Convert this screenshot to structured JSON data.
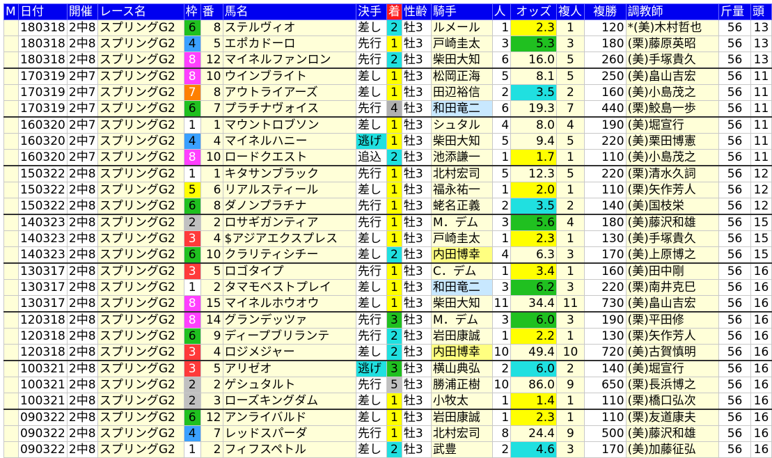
{
  "header": {
    "m": "M",
    "date": "日付",
    "venue": "開催",
    "race": "レース名",
    "waku": "枠",
    "ban": "番",
    "horse": "馬名",
    "kimete": "決手",
    "chaku": "着",
    "seirei": "性齢",
    "jockey": "騎手",
    "ninki": "人",
    "odds": "オッズ",
    "fukusho_ninki": "複人",
    "fukusho": "複勝",
    "trainer": "調教師",
    "kinryo": "斤量",
    "tousu": "頭"
  },
  "colors": {
    "header_bg": "#0000f0",
    "chaku_header_bg": "#ff1a1a",
    "row_bg": "#ffffd8",
    "waku": {
      "1": "#ffffff",
      "2": "#c0c0c0",
      "3": "#ff3a3a",
      "4": "#3aa0ff",
      "5": "#ffff00",
      "6": "#20c020",
      "7": "#ff8000",
      "8": "#ff40ff"
    },
    "chaku": {
      "1": "#ffff00",
      "2": "#20e0e0",
      "3": "#20c020",
      "4": "#b0b0b0",
      "5": "#c0c0c0"
    },
    "odds": {
      "1": "#ffff00",
      "2": "#20e0e0",
      "3": "#20c020"
    },
    "trainer_miho": "#d45f00",
    "trainer_ritto": "#0000c0"
  },
  "rows": [
    {
      "m": "",
      "date": "180318",
      "venue": "2中8",
      "race": "スプリングG2",
      "waku": "6",
      "ban": "8",
      "horse": "ステルヴィオ",
      "kimete": "差し",
      "chaku": "2",
      "seirei": "牡3",
      "jockey": "ルメール",
      "jc": "b",
      "ninki": "1",
      "odds": "2.3",
      "oc": "1",
      "fn": "1",
      "fukusho": "120",
      "trainer": "*(美)木村哲也",
      "tc": "m",
      "kinryo": "56",
      "tousu": "13"
    },
    {
      "m": "",
      "date": "180318",
      "venue": "2中8",
      "race": "スプリングG2",
      "waku": "4",
      "ban": "5",
      "horse": "エポカドーロ",
      "kimete": "先行",
      "chaku": "1",
      "seirei": "牡3",
      "jockey": "戸崎圭太",
      "jc": "o",
      "ninki": "3",
      "odds": "5.3",
      "oc": "3",
      "fn": "3",
      "fukusho": "180",
      "trainer": "(栗)藤原英昭",
      "tc": "k",
      "kinryo": "56",
      "tousu": "13"
    },
    {
      "m": "",
      "date": "180318",
      "venue": "2中8",
      "race": "スプリングG2",
      "waku": "8",
      "ban": "12",
      "horse": "マイネルファンロン",
      "kimete": "先行",
      "chaku": "2",
      "seirei": "牡3",
      "jockey": "柴田大知",
      "jc": "o",
      "ninki": "6",
      "odds": "16.0",
      "oc": "",
      "fn": "5",
      "fukusho": "260",
      "trainer": "(美)手塚貴久",
      "tc": "m",
      "kinryo": "56",
      "tousu": "13"
    },
    {
      "sep": true,
      "m": "",
      "date": "170319",
      "venue": "2中7",
      "race": "スプリングG2",
      "waku": "8",
      "ban": "10",
      "horse": "ウインブライト",
      "kimete": "差し",
      "chaku": "1",
      "seirei": "牡3",
      "jockey": "松岡正海",
      "jc": "o",
      "ninki": "5",
      "odds": "8.1",
      "oc": "",
      "fn": "5",
      "fukusho": "250",
      "trainer": "(美)畠山吉宏",
      "tc": "m",
      "kinryo": "56",
      "tousu": "11"
    },
    {
      "m": "",
      "date": "170319",
      "venue": "2中7",
      "race": "スプリングG2",
      "waku": "7",
      "ban": "8",
      "horse": "アウトライアーズ",
      "kimete": "差し",
      "chaku": "1",
      "seirei": "牡3",
      "jockey": "田辺裕信",
      "jc": "o",
      "ninki": "2",
      "odds": "3.5",
      "oc": "2",
      "fn": "2",
      "fukusho": "160",
      "trainer": "(美)小島茂之",
      "tc": "m",
      "kinryo": "56",
      "tousu": "11"
    },
    {
      "m": "",
      "date": "170319",
      "venue": "2中7",
      "race": "スプリングG2",
      "waku": "6",
      "ban": "7",
      "horse": "プラチナヴォイス",
      "kimete": "先行",
      "chaku": "4",
      "seirei": "牡3",
      "jockey": "和田竜二",
      "jc": "hb",
      "ninki": "6",
      "odds": "19.3",
      "oc": "",
      "fn": "7",
      "fukusho": "440",
      "trainer": "(栗)鮫島一歩",
      "tc": "k",
      "kinryo": "56",
      "tousu": "11"
    },
    {
      "sep": true,
      "m": "",
      "date": "160320",
      "venue": "2中7",
      "race": "スプリングG2",
      "waku": "1",
      "ban": "1",
      "horse": "マウントロブソン",
      "kimete": "差し",
      "chaku": "1",
      "seirei": "牡3",
      "jockey": "シュタル",
      "jc": "o",
      "ninki": "4",
      "odds": "8.0",
      "oc": "",
      "fn": "4",
      "fukusho": "190",
      "trainer": "(美)堀宣行",
      "tc": "m",
      "kinryo": "56",
      "tousu": "11"
    },
    {
      "m": "",
      "date": "160320",
      "venue": "2中7",
      "race": "スプリングG2",
      "waku": "4",
      "ban": "4",
      "horse": "マイネルハニー",
      "kimete": "逃げ",
      "chaku": "1",
      "seirei": "牡3",
      "jockey": "柴田大知",
      "jc": "o",
      "ninki": "5",
      "odds": "9.4",
      "oc": "",
      "fn": "5",
      "fukusho": "220",
      "trainer": "(美)栗田博憲",
      "tc": "m",
      "kinryo": "56",
      "tousu": "11"
    },
    {
      "m": "",
      "date": "160320",
      "venue": "2中7",
      "race": "スプリングG2",
      "waku": "8",
      "ban": "10",
      "horse": "ロードクエスト",
      "kimete": "追込",
      "chaku": "2",
      "seirei": "牡3",
      "jockey": "池添謙一",
      "jc": "b",
      "ninki": "1",
      "odds": "1.7",
      "oc": "1",
      "fn": "1",
      "fukusho": "110",
      "trainer": "(美)小島茂之",
      "tc": "m",
      "kinryo": "56",
      "tousu": "11"
    },
    {
      "sep": true,
      "m": "",
      "date": "150322",
      "venue": "2中8",
      "race": "スプリングG2",
      "waku": "1",
      "ban": "1",
      "horse": "キタサンブラック",
      "kimete": "先行",
      "chaku": "1",
      "seirei": "牡3",
      "jockey": "北村宏司",
      "jc": "o",
      "ninki": "5",
      "odds": "12.3",
      "oc": "",
      "fn": "5",
      "fukusho": "220",
      "trainer": "(栗)清水久詞",
      "tc": "k",
      "kinryo": "56",
      "tousu": "12"
    },
    {
      "m": "",
      "date": "150322",
      "venue": "2中8",
      "race": "スプリングG2",
      "waku": "5",
      "ban": "6",
      "horse": "リアルスティール",
      "kimete": "差し",
      "chaku": "1",
      "seirei": "牡3",
      "jockey": "福永祐一",
      "jc": "b",
      "ninki": "1",
      "odds": "2.0",
      "oc": "1",
      "fn": "1",
      "fukusho": "110",
      "trainer": "(栗)矢作芳人",
      "tc": "k",
      "kinryo": "56",
      "tousu": "12"
    },
    {
      "m": "",
      "date": "150322",
      "venue": "2中8",
      "race": "スプリングG2",
      "waku": "6",
      "ban": "8",
      "horse": "ダノンプラチナ",
      "kimete": "先行",
      "chaku": "1",
      "seirei": "牡3",
      "jockey": "蛯名正義",
      "jc": "o",
      "ninki": "2",
      "odds": "3.5",
      "oc": "2",
      "fn": "2",
      "fukusho": "140",
      "trainer": "(美)国枝栄",
      "tc": "m",
      "kinryo": "56",
      "tousu": "12"
    },
    {
      "sep": true,
      "m": "",
      "date": "140323",
      "venue": "2中8",
      "race": "スプリングG2",
      "waku": "2",
      "ban": "2",
      "horse": "ロサギガンティア",
      "kimete": "先行",
      "chaku": "1",
      "seirei": "牡3",
      "jockey": "M．デム",
      "jc": "b",
      "ninki": "3",
      "odds": "5.6",
      "oc": "3",
      "fn": "4",
      "fukusho": "180",
      "trainer": "(美)藤沢和雄",
      "tc": "m",
      "kinryo": "56",
      "tousu": "15"
    },
    {
      "m": "",
      "date": "140323",
      "venue": "2中8",
      "race": "スプリングG2",
      "waku": "3",
      "ban": "4",
      "horse": "$アジアエクスプレス",
      "kimete": "差し",
      "chaku": "1",
      "seirei": "牡3",
      "jockey": "戸崎圭太",
      "jc": "o",
      "ninki": "1",
      "odds": "2.3",
      "oc": "1",
      "fn": "1",
      "fukusho": "130",
      "trainer": "(美)手塚貴久",
      "tc": "m",
      "kinryo": "56",
      "tousu": "15"
    },
    {
      "m": "",
      "date": "140323",
      "venue": "2中8",
      "race": "スプリングG2",
      "waku": "6",
      "ban": "10",
      "horse": "クラリティシチー",
      "kimete": "差し",
      "chaku": "2",
      "seirei": "牡3",
      "jockey": "内田博幸",
      "jc": "hl",
      "ninki": "4",
      "odds": "6.3",
      "oc": "",
      "fn": "3",
      "fukusho": "170",
      "trainer": "(美)上原博之",
      "tc": "m",
      "kinryo": "56",
      "tousu": "15"
    },
    {
      "sep": true,
      "m": "",
      "date": "130317",
      "venue": "2中8",
      "race": "スプリングG2",
      "waku": "3",
      "ban": "5",
      "horse": "ロゴタイプ",
      "kimete": "先行",
      "chaku": "1",
      "seirei": "牡3",
      "jockey": "C．デム",
      "jc": "o",
      "ninki": "1",
      "odds": "3.4",
      "oc": "1",
      "fn": "1",
      "fukusho": "160",
      "trainer": "(美)田中剛",
      "tc": "m",
      "kinryo": "56",
      "tousu": "16"
    },
    {
      "m": "",
      "date": "130317",
      "venue": "2中8",
      "race": "スプリングG2",
      "waku": "1",
      "ban": "2",
      "horse": "タマモベストプレイ",
      "kimete": "差し",
      "chaku": "1",
      "seirei": "牡3",
      "jockey": "和田竜二",
      "jc": "hb",
      "ninki": "3",
      "odds": "6.2",
      "oc": "3",
      "fn": "3",
      "fukusho": "220",
      "trainer": "(栗)南井克巳",
      "tc": "k",
      "kinryo": "56",
      "tousu": "16"
    },
    {
      "m": "",
      "date": "130317",
      "venue": "2中8",
      "race": "スプリングG2",
      "waku": "8",
      "ban": "15",
      "horse": "マイネルホウオウ",
      "kimete": "差し",
      "chaku": "1",
      "seirei": "牡3",
      "jockey": "柴田大知",
      "jc": "o",
      "ninki": "11",
      "odds": "34.4",
      "oc": "",
      "fn": "11",
      "fukusho": "730",
      "trainer": "(美)畠山吉宏",
      "tc": "m",
      "kinryo": "56",
      "tousu": "16"
    },
    {
      "sep": true,
      "m": "",
      "date": "120318",
      "venue": "2中8",
      "race": "スプリングG2",
      "waku": "8",
      "ban": "14",
      "horse": "グランデッツァ",
      "kimete": "先行",
      "chaku": "3",
      "seirei": "牡3",
      "jockey": "M．デム",
      "jc": "b",
      "ninki": "3",
      "odds": "6.0",
      "oc": "3",
      "fn": "3",
      "fukusho": "190",
      "trainer": "(栗)平田修",
      "tc": "k",
      "kinryo": "56",
      "tousu": "16"
    },
    {
      "m": "",
      "date": "120318",
      "venue": "2中8",
      "race": "スプリングG2",
      "waku": "6",
      "ban": "9",
      "horse": "ディープブリランテ",
      "kimete": "先行",
      "chaku": "2",
      "seirei": "牡3",
      "jockey": "岩田康誠",
      "jc": "b",
      "ninki": "1",
      "odds": "2.2",
      "oc": "1",
      "fn": "1",
      "fukusho": "130",
      "trainer": "(栗)矢作芳人",
      "tc": "k",
      "kinryo": "56",
      "tousu": "16"
    },
    {
      "m": "",
      "date": "120318",
      "venue": "2中8",
      "race": "スプリングG2",
      "waku": "3",
      "ban": "4",
      "horse": "ロジメジャー",
      "kimete": "差し",
      "chaku": "2",
      "seirei": "牡3",
      "jockey": "内田博幸",
      "jc": "hl",
      "ninki": "10",
      "odds": "49.4",
      "oc": "",
      "fn": "10",
      "fukusho": "720",
      "trainer": "(美)古賀慎明",
      "tc": "m",
      "kinryo": "56",
      "tousu": "16"
    },
    {
      "sep": true,
      "m": "",
      "date": "100321",
      "venue": "2中8",
      "race": "スプリングG2",
      "waku": "3",
      "ban": "5",
      "horse": "アリゼオ",
      "kimete": "逃げ",
      "chaku": "3",
      "seirei": "牡3",
      "jockey": "横山典弘",
      "jc": "o",
      "ninki": "2",
      "odds": "6.0",
      "oc": "2",
      "fn": "2",
      "fukusho": "140",
      "trainer": "(美)堀宣行",
      "tc": "m",
      "kinryo": "56",
      "tousu": "16"
    },
    {
      "m": "",
      "date": "100321",
      "venue": "2中8",
      "race": "スプリングG2",
      "waku": "2",
      "ban": "2",
      "horse": "ゲシュタルト",
      "kimete": "先行",
      "chaku": "5",
      "seirei": "牡3",
      "jockey": "勝浦正樹",
      "jc": "o",
      "ninki": "10",
      "odds": "86.0",
      "oc": "",
      "fn": "9",
      "fukusho": "650",
      "trainer": "(栗)長浜博之",
      "tc": "k",
      "kinryo": "56",
      "tousu": "16"
    },
    {
      "m": "",
      "date": "100321",
      "venue": "2中8",
      "race": "スプリングG2",
      "waku": "2",
      "ban": "3",
      "horse": "ローズキングダム",
      "kimete": "差し",
      "chaku": "1",
      "seirei": "牡3",
      "jockey": "小牧太",
      "jc": "b",
      "ninki": "1",
      "odds": "1.4",
      "oc": "1",
      "fn": "1",
      "fukusho": "110",
      "trainer": "(栗)橋口弘次",
      "tc": "k",
      "kinryo": "56",
      "tousu": "16"
    },
    {
      "sep": true,
      "m": "",
      "date": "090322",
      "venue": "2中8",
      "race": "スプリングG2",
      "waku": "6",
      "ban": "12",
      "horse": "アンライバルド",
      "kimete": "差し",
      "chaku": "1",
      "seirei": "牡3",
      "jockey": "岩田康誠",
      "jc": "b",
      "ninki": "1",
      "odds": "2.3",
      "oc": "1",
      "fn": "1",
      "fukusho": "110",
      "trainer": "(栗)友道康夫",
      "tc": "k",
      "kinryo": "56",
      "tousu": "16"
    },
    {
      "m": "",
      "date": "090322",
      "venue": "2中8",
      "race": "スプリングG2",
      "waku": "4",
      "ban": "7",
      "horse": "レッドスパーダ",
      "kimete": "先行",
      "chaku": "1",
      "seirei": "牡3",
      "jockey": "北村宏司",
      "jc": "o",
      "ninki": "8",
      "odds": "24.4",
      "oc": "",
      "fn": "9",
      "fukusho": "500",
      "trainer": "(美)藤沢和雄",
      "tc": "m",
      "kinryo": "56",
      "tousu": "16"
    },
    {
      "m": "",
      "date": "090322",
      "venue": "2中8",
      "race": "スプリングG2",
      "waku": "1",
      "ban": "2",
      "horse": "フィフスペトル",
      "kimete": "差し",
      "chaku": "2",
      "seirei": "牡3",
      "jockey": "武豊",
      "jc": "b",
      "ninki": "2",
      "odds": "4.6",
      "oc": "2",
      "fn": "3",
      "fukusho": "170",
      "trainer": "(美)加藤征弘",
      "tc": "m",
      "kinryo": "56",
      "tousu": "16"
    }
  ]
}
